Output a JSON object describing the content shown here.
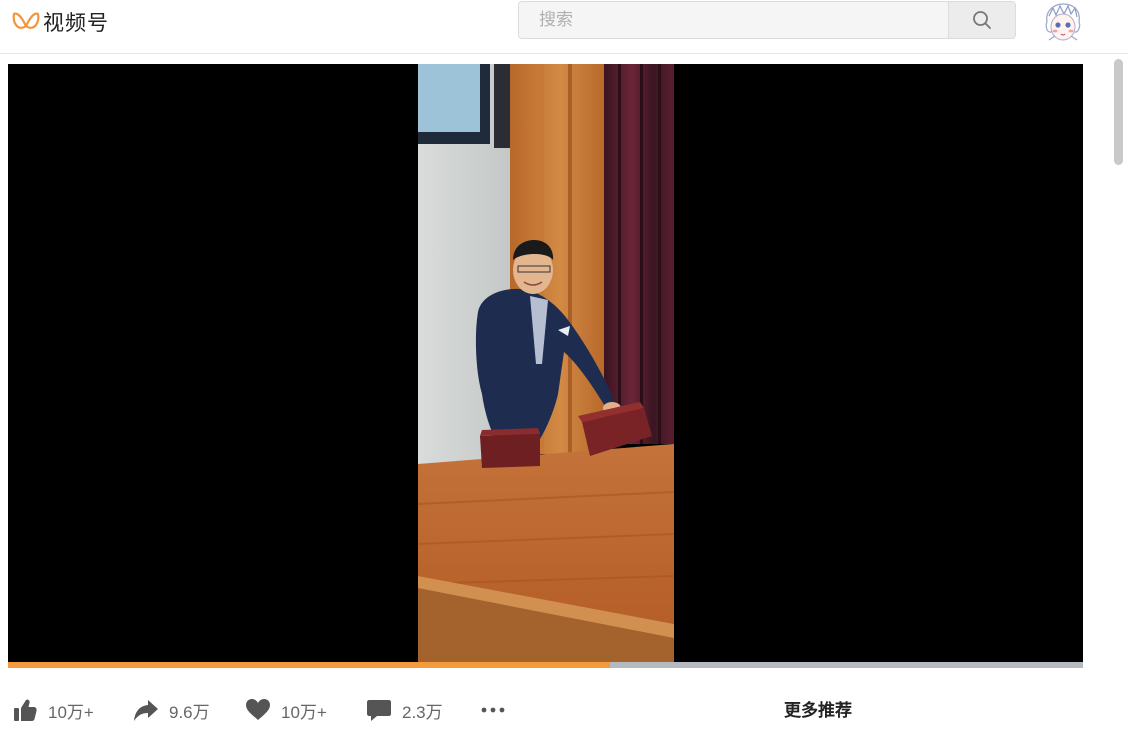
{
  "app": {
    "name": "视频号"
  },
  "search": {
    "placeholder": "搜索",
    "value": ""
  },
  "video": {
    "progress_percent": 56
  },
  "actions": {
    "like_count": "10万+",
    "share_count": "9.6万",
    "favorite_count": "10万+",
    "comment_count": "2.3万"
  },
  "sidebar": {
    "title": "更多推荐"
  },
  "colors": {
    "accent": "#f39a3c",
    "logo_orange": "#f3963a"
  },
  "icons": [
    "logo-icon",
    "search-icon",
    "avatar",
    "thumbs-up-icon",
    "share-icon",
    "heart-icon",
    "comment-icon",
    "more-icon"
  ]
}
